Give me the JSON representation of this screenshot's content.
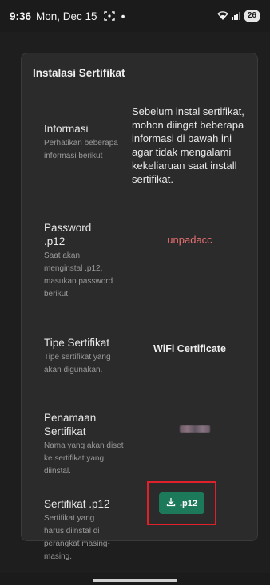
{
  "status_bar": {
    "time": "9:36",
    "date": "Mon, Dec 15",
    "dot": "•",
    "battery": "26",
    "icons": [
      "screen-record-icon",
      "wifi-icon",
      "signal-icon"
    ]
  },
  "panel": {
    "title": "Instalasi Sertifikat",
    "rows": [
      {
        "label": "Informasi",
        "desc": "Perhatikan beberapa informasi berikut",
        "value": "Sebelum instal sertifikat, mohon diingat beberapa informasi di bawah ini agar tidak mengalami kekeliaruan saat install sertifikat."
      },
      {
        "label": "Password .p12",
        "desc": "Saat akan menginstal .p12, masukan password berikut.",
        "value": "unpadacc"
      },
      {
        "label": "Tipe Sertifikat",
        "desc": "Tipe sertifikat yang akan digunakan.",
        "value": "WiFi Certificate"
      },
      {
        "label": "Penamaan Sertifikat",
        "desc": "Nama yang akan diset ke sertifikat yang diinstal.",
        "value": ""
      },
      {
        "label": "Sertifikat .p12",
        "desc": "Sertifikat yang harus diinstal di perangkat masing-masing.",
        "button": ".p12"
      }
    ]
  },
  "colors": {
    "accent_button": "#1c7a5a",
    "password_text": "#e87070",
    "highlight": "#e0202a"
  }
}
